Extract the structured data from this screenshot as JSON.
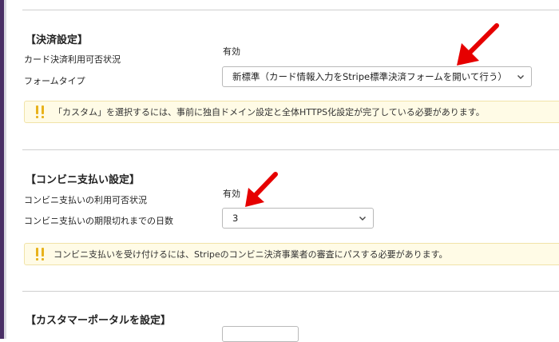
{
  "payment": {
    "title": "【決済設定】",
    "card_status_label": "カード決済利用可否状況",
    "card_status_value": "有効",
    "form_type_label": "フォームタイプ",
    "form_type_value": "新標準（カード情報入力をStripe標準決済フォームを開いて行う）",
    "notice": "「カスタム」を選択するには、事前に独自ドメイン設定と全体HTTPS化設定が完了している必要があります。"
  },
  "konbini": {
    "title": "【コンビニ支払い設定】",
    "status_label": "コンビニ支払いの利用可否状況",
    "status_value": "有効",
    "days_label": "コンビニ支払いの期限切れまでの日数",
    "days_value": "3",
    "notice": "コンビニ支払いを受け付けるには、Stripeのコンビニ決済事業者の審査にパスする必要があります。"
  },
  "portal": {
    "title": "【カスタマーポータルを設定】"
  },
  "icons": {
    "warning": "exclamation-warning-icon",
    "chevron": "chevron-down-icon",
    "arrow": "red-annotation-arrow"
  },
  "colors": {
    "frame": "#4a2f66",
    "notice_bg": "#fffbe6",
    "notice_icon": "#e8b21c",
    "arrow": "#e60000"
  }
}
